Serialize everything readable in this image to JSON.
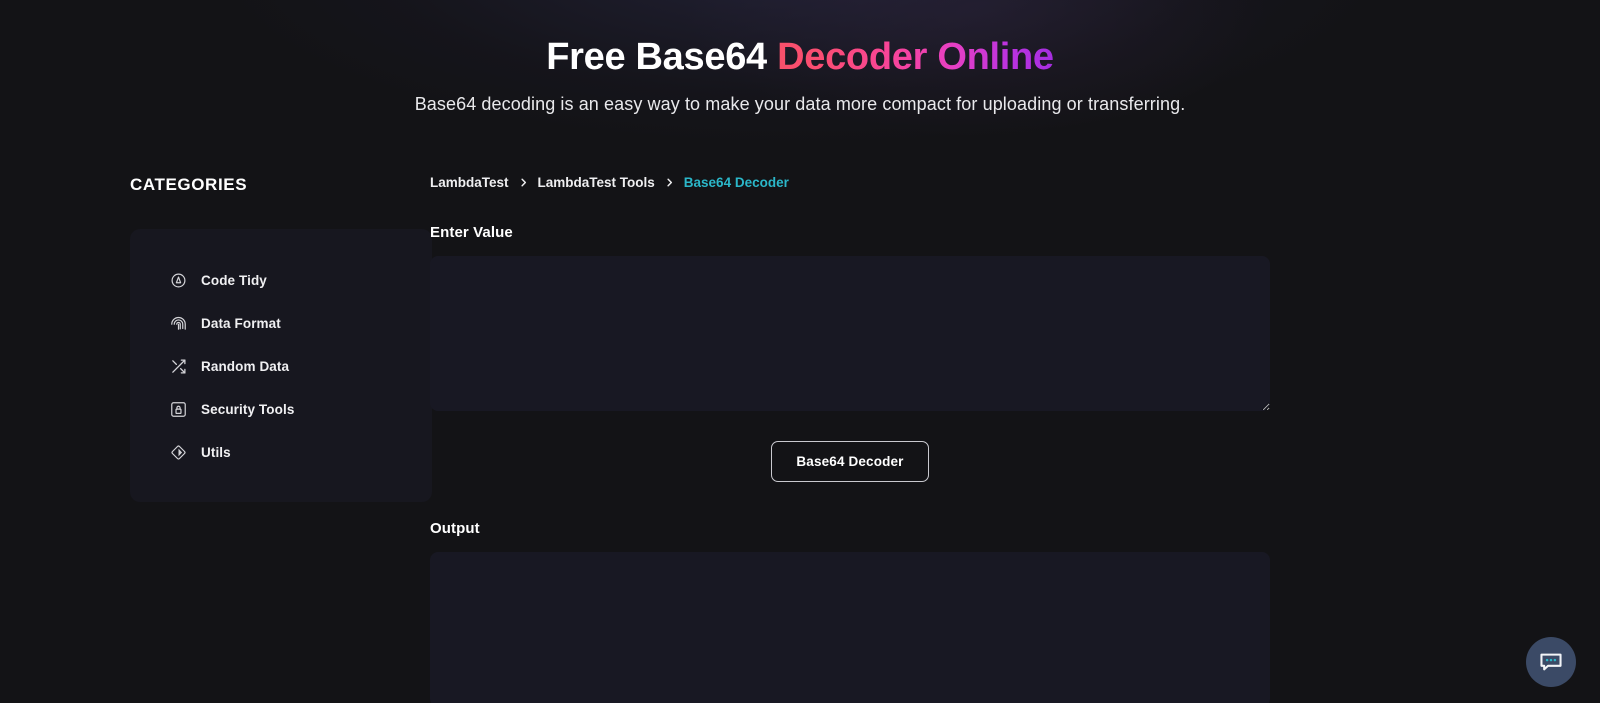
{
  "hero": {
    "title_plain": "Free Base64 ",
    "title_gradient": "Decoder Online",
    "subtitle": "Base64 decoding is an easy way to make your data more compact for uploading or transferring."
  },
  "sidebar": {
    "heading": "CATEGORIES",
    "items": [
      {
        "label": "Code Tidy",
        "icon": "code-tidy-icon"
      },
      {
        "label": "Data Format",
        "icon": "fingerprint-icon"
      },
      {
        "label": "Random Data",
        "icon": "shuffle-icon"
      },
      {
        "label": "Security Tools",
        "icon": "lock-icon"
      },
      {
        "label": "Utils",
        "icon": "diamond-icon"
      }
    ]
  },
  "breadcrumb": {
    "items": [
      {
        "label": "LambdaTest",
        "active": false
      },
      {
        "label": "LambdaTest Tools",
        "active": false
      },
      {
        "label": "Base64 Decoder",
        "active": true
      }
    ],
    "separator_icon": "chevron-right-icon"
  },
  "main": {
    "input_label": "Enter Value",
    "input_value": "",
    "input_placeholder": "",
    "action_button": "Base64 Decoder",
    "output_label": "Output",
    "output_value": "",
    "output_placeholder": ""
  },
  "chat": {
    "icon": "chat-bubble-icon",
    "dot_color": "#2bb7c9",
    "bubble_color": "#3b4a66"
  },
  "colors": {
    "page_bg": "#131316",
    "card_bg": "#17171f",
    "field_bg": "#181823",
    "accent_link": "#2bb7c9",
    "gradient_start": "#f8506a",
    "gradient_end": "#a52ee0",
    "text_primary": "#ffffff"
  }
}
